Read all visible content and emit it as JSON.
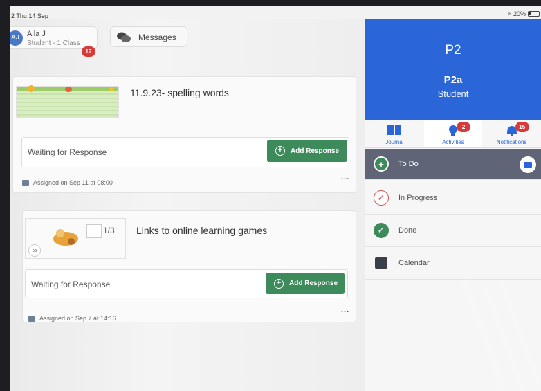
{
  "status_bar": {
    "time": "2  Thu 14 Sep",
    "battery": "20%"
  },
  "user": {
    "initials": "AJ",
    "name": "Aila J",
    "role": "Student - 1 Class",
    "badge": "17"
  },
  "messages": {
    "label": "Messages"
  },
  "posts": [
    {
      "title": "11.9.23- spelling words",
      "status": "Waiting for Response",
      "action_label": "Add Response",
      "assigned": "Assigned on Sep 11 at 08:00",
      "more": "..."
    },
    {
      "title": "Links to online learning games",
      "status": "Waiting for Response",
      "action_label": "Add Response",
      "assigned": "Assigned on Sep 7 at 14:16",
      "more": "...",
      "thumb_counter": "1/3"
    }
  ],
  "class_panel": {
    "code": "P2",
    "name": "P2a",
    "role": "Student",
    "tabs": [
      {
        "label": "Journal",
        "badge": ""
      },
      {
        "label": "Activities",
        "badge": "2"
      },
      {
        "label": "Notifications",
        "badge": "15"
      }
    ],
    "menu": [
      {
        "label": "To Do",
        "icon": "plus-circle-icon"
      },
      {
        "label": "In Progress",
        "icon": "check-outline-icon"
      },
      {
        "label": "Done",
        "icon": "check-filled-icon"
      },
      {
        "label": "Calendar",
        "icon": "calendar-icon"
      }
    ]
  },
  "colors": {
    "brand_blue": "#2a66d8",
    "action_green": "#3d8b5a",
    "badge_red": "#d63b3b",
    "selected_row": "#5f6476"
  }
}
